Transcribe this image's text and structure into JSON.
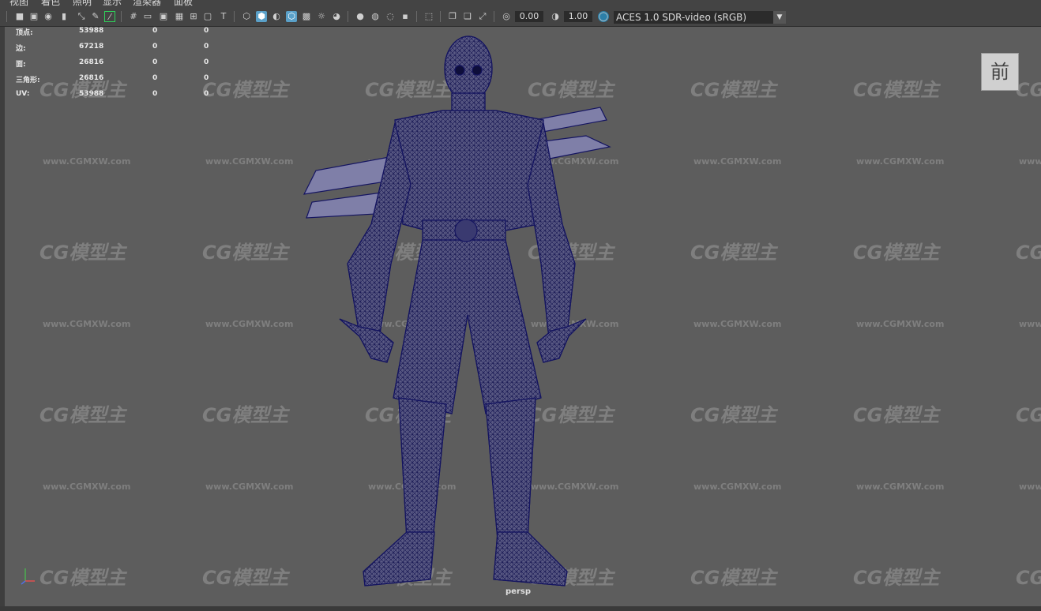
{
  "menu": [
    "视图",
    "着色",
    "照明",
    "显示",
    "渲染器",
    "面板"
  ],
  "toolbar": {
    "exposure": "0.00",
    "gamma": "1.00",
    "color_space": "ACES 1.0 SDR-video (sRGB)"
  },
  "hud": {
    "rows": [
      {
        "label": "顶点:",
        "v1": "53988",
        "v2": "0",
        "v3": "0"
      },
      {
        "label": "边:",
        "v1": "67218",
        "v2": "0",
        "v3": "0"
      },
      {
        "label": "面:",
        "v1": "26816",
        "v2": "0",
        "v3": "0"
      },
      {
        "label": "三角形:",
        "v1": "26816",
        "v2": "0",
        "v3": "0"
      },
      {
        "label": "UV:",
        "v1": "53988",
        "v2": "0",
        "v3": "0"
      }
    ]
  },
  "viewcube_label": "前",
  "camera_label": "persp",
  "watermark": {
    "logo": "CG模型主",
    "url": "www.CGMXW.com"
  },
  "colors": {
    "wire": "#1a1a6e",
    "viewport_bg": "#5d5d5d",
    "active_icon": "#5aa0c8"
  }
}
